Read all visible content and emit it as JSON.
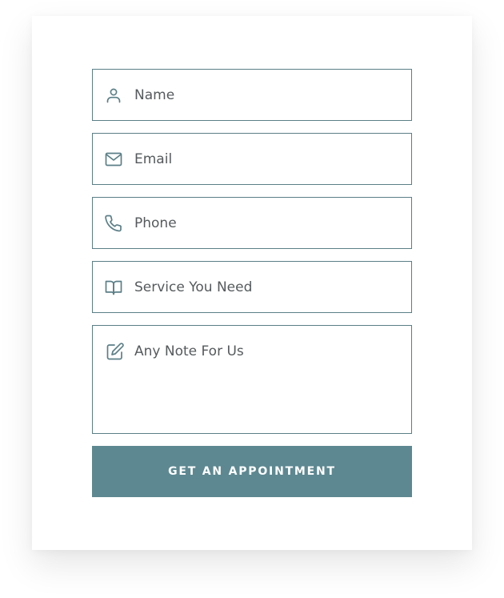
{
  "form": {
    "fields": {
      "name": {
        "placeholder": "Name",
        "value": "",
        "icon": "user-icon"
      },
      "email": {
        "placeholder": "Email",
        "value": "",
        "icon": "mail-icon"
      },
      "phone": {
        "placeholder": "Phone",
        "value": "",
        "icon": "phone-icon"
      },
      "service": {
        "placeholder": "Service You Need",
        "value": "",
        "icon": "book-icon"
      },
      "note": {
        "placeholder": "Any Note For Us",
        "value": "",
        "icon": "edit-icon"
      }
    },
    "submit_label": "GET AN APPOINTMENT"
  },
  "colors": {
    "border": "#5b7f87",
    "button": "#5d8891",
    "icon": "#5b7f87",
    "button_text": "#ffffff"
  }
}
